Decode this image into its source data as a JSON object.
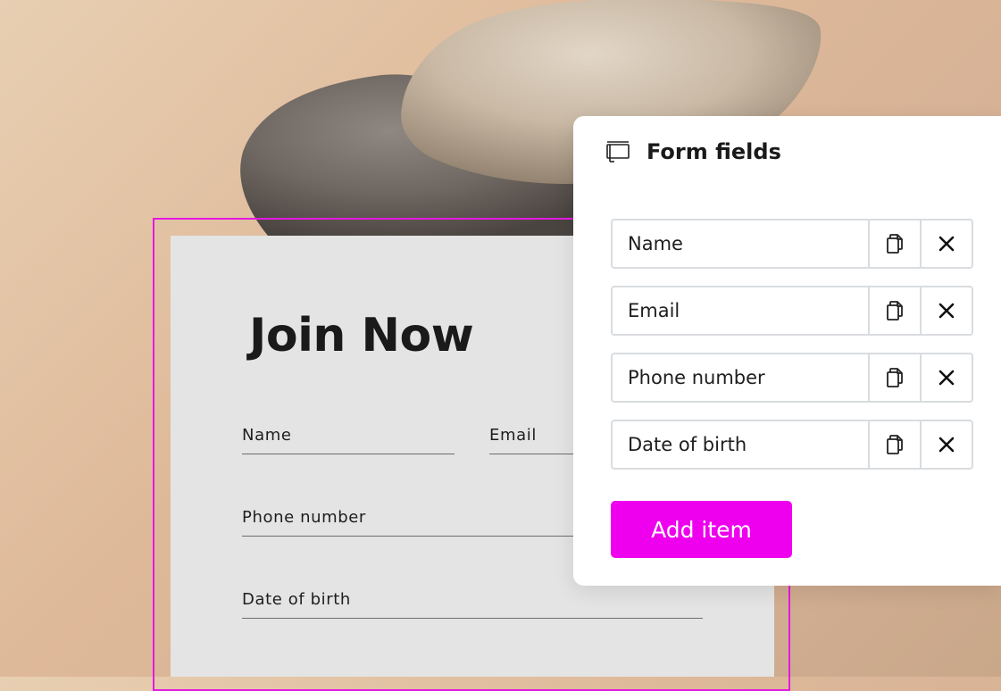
{
  "form": {
    "title": "Join Now",
    "fields": {
      "name": "Name",
      "email": "Email",
      "phone": "Phone number",
      "dob": "Date of birth"
    }
  },
  "panel": {
    "title": "Form fields",
    "icon": "form-icon",
    "items": [
      {
        "label": "Name"
      },
      {
        "label": "Email"
      },
      {
        "label": "Phone number"
      },
      {
        "label": "Date of birth"
      }
    ],
    "add_label": "Add item"
  },
  "colors": {
    "accent": "#ee00ee",
    "selection": "#e419e0",
    "card": "#e4e4e4",
    "background": "#deb999"
  }
}
